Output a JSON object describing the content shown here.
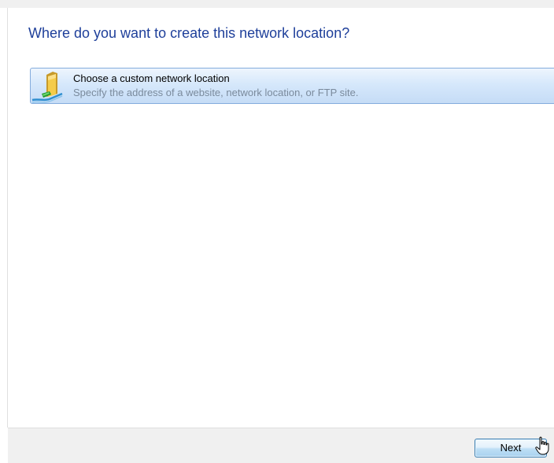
{
  "wizard": {
    "heading": "Where do you want to create this network location?",
    "options": [
      {
        "title": "Choose a custom network location",
        "description": "Specify the address of a website, network location, or FTP site.",
        "icon": "network-folder-icon",
        "selected": true
      }
    ]
  },
  "footer": {
    "next_label": "Next"
  },
  "cursor": {
    "icon": "hand-pointer-icon"
  },
  "colors": {
    "heading": "#1e3f9a",
    "option_border": "#84acdd",
    "option_description": "#7a8a9c",
    "footer_background": "#f0f0f0"
  }
}
